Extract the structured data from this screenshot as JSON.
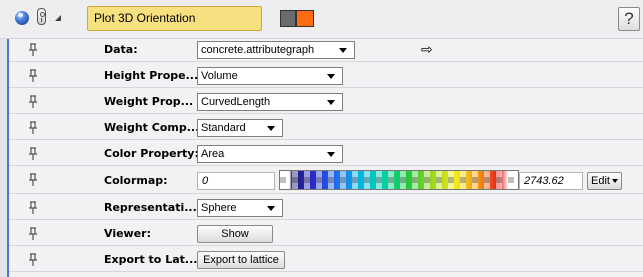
{
  "header": {
    "title": "Plot 3D Orientation",
    "help_label": "?",
    "icons": [
      "sphere-icon",
      "lock-icon",
      "collapse-triangle-icon",
      "color-swatch-icon",
      "help-icon"
    ],
    "swatch_colors": [
      "#6a6a6a",
      "#ff6a12"
    ]
  },
  "ports": [
    {
      "label": "Data:",
      "value": "concrete.attributegraph"
    },
    {
      "label": "Height Prope...",
      "value": "Volume"
    },
    {
      "label": "Weight Prop...",
      "value": "CurvedLength"
    },
    {
      "label": "Weight Comp...",
      "value": "Standard"
    },
    {
      "label": "Color Property:",
      "value": "Area"
    },
    {
      "label": "Colormap:",
      "min": "0",
      "max": "2743.62",
      "edit_label": "Edit"
    },
    {
      "label": "Representati...",
      "value": "Sphere"
    },
    {
      "label": "Viewer:",
      "button": "Show"
    },
    {
      "label": "Export to Lat...",
      "button": "Export to lattice"
    }
  ],
  "accent_color": "#4a78c9"
}
